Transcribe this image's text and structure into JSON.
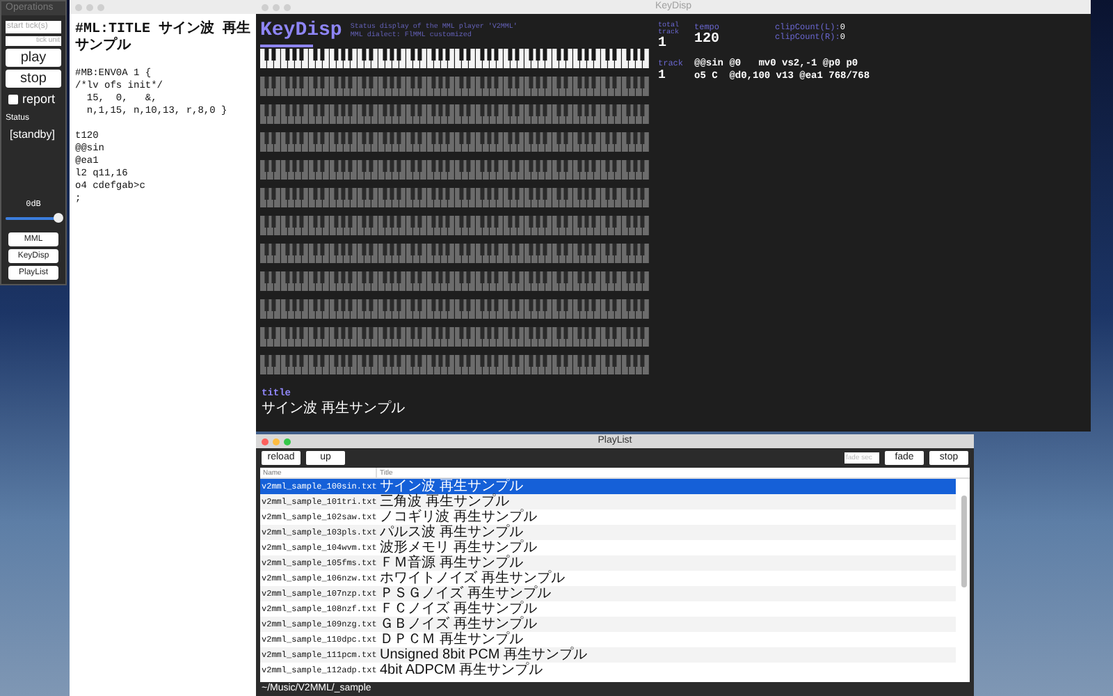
{
  "operations": {
    "title": "Operations",
    "active": false,
    "start_tick": {
      "placeholder": "start tick(s)"
    },
    "tick_unit": {
      "placeholder": "tick unit"
    },
    "buttons": [
      "play",
      "stop"
    ],
    "report": {
      "label": "report",
      "checked": false
    },
    "status_label": "Status",
    "status": "[standby]",
    "volume": {
      "reading": "0dB",
      "level": 0.95
    },
    "window_buttons": [
      "MML",
      "KeyDisp",
      "PlayList"
    ]
  },
  "editor": {
    "active": false,
    "blocks": [
      [
        "#ML:TITLE サイン波 再生サンプル"
      ],
      [
        "#MB:ENV0A 1 {",
        "/*lv ofs init*/",
        "  15,  0,   &,",
        "  n,1,15, n,10,13, r,8,0 }"
      ],
      [
        "t120",
        "@@sin",
        "@ea1",
        "l2 q11,16",
        "o4 cdefgab>c",
        ";"
      ]
    ]
  },
  "keydisp": {
    "title": "KeyDisp",
    "active": false,
    "heading": "KeyDisp",
    "subtitle_lines": [
      "Status display of the MML player 'V2MML'",
      "MML dialect: FlMML customized"
    ],
    "total_track": {
      "label": "total track",
      "value": "1"
    },
    "tempo": {
      "label": "tempo",
      "value": "120"
    },
    "clip_counts": [
      {
        "label": "clipCount(L):",
        "value": "0"
      },
      {
        "label": "clipCount(R):",
        "value": "0"
      }
    ],
    "track": {
      "label": "track",
      "value": "1",
      "lines": [
        "@@sin @0   mv0 vs2,-1 @p0 p0",
        "o5 C  @d0,100 v13 @ea1 768/768"
      ]
    },
    "song_title": {
      "label": "title",
      "value": "サイン波 再生サンプル"
    }
  },
  "playlist": {
    "title": "PlayList",
    "active": true,
    "left_buttons": [
      "reload",
      "up"
    ],
    "fade_sec": {
      "placeholder": "fade sec"
    },
    "right_buttons": [
      "fade",
      "stop"
    ],
    "columns": [
      "Name",
      "Title"
    ],
    "rows": [
      {
        "name": "v2mml_sample_100sin.txt",
        "title": "サイン波 再生サンプル",
        "selected": true
      },
      {
        "name": "v2mml_sample_101tri.txt",
        "title": "三角波 再生サンプル",
        "selected": false
      },
      {
        "name": "v2mml_sample_102saw.txt",
        "title": "ノコギリ波 再生サンプル",
        "selected": false
      },
      {
        "name": "v2mml_sample_103pls.txt",
        "title": "パルス波 再生サンプル",
        "selected": false
      },
      {
        "name": "v2mml_sample_104wvm.txt",
        "title": "波形メモリ 再生サンプル",
        "selected": false
      },
      {
        "name": "v2mml_sample_105fms.txt",
        "title": "ＦＭ音源 再生サンプル",
        "selected": false
      },
      {
        "name": "v2mml_sample_106nzw.txt",
        "title": "ホワイトノイズ 再生サンプル",
        "selected": false
      },
      {
        "name": "v2mml_sample_107nzp.txt",
        "title": "ＰＳＧノイズ 再生サンプル",
        "selected": false
      },
      {
        "name": "v2mml_sample_108nzf.txt",
        "title": "ＦＣノイズ 再生サンプル",
        "selected": false
      },
      {
        "name": "v2mml_sample_109nzg.txt",
        "title": "ＧＢノイズ 再生サンプル",
        "selected": false
      },
      {
        "name": "v2mml_sample_110dpc.txt",
        "title": "ＤＰＣＭ 再生サンプル",
        "selected": false
      },
      {
        "name": "v2mml_sample_111pcm.txt",
        "title": "Unsigned 8bit PCM 再生サンプル",
        "selected": false
      },
      {
        "name": "v2mml_sample_112adp.txt",
        "title": "4bit ADPCM 再生サンプル",
        "selected": false
      }
    ],
    "path": "~/Music/V2MML/_sample"
  }
}
